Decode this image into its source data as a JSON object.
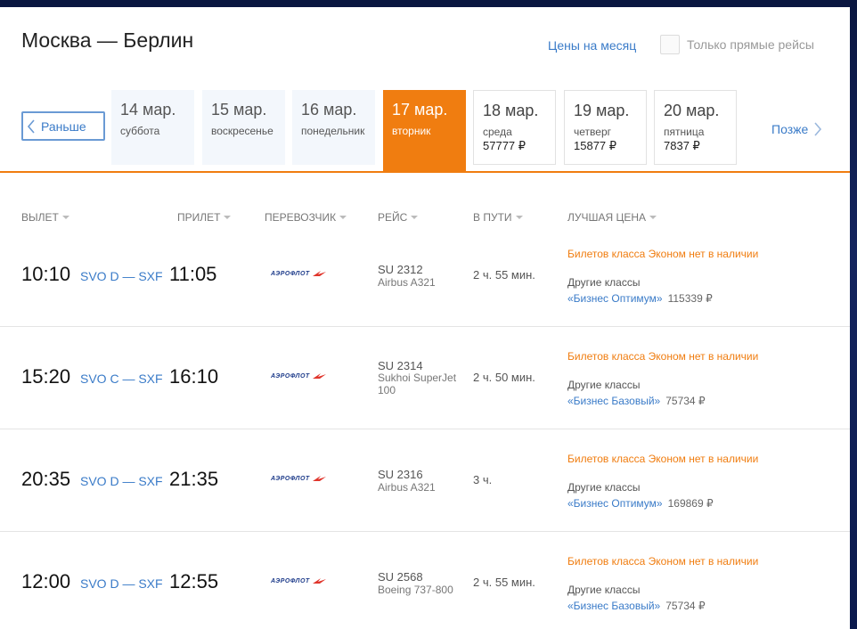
{
  "header": {
    "route": "Москва — Берлин",
    "month_prices_link": "Цены на месяц",
    "direct_only_label": "Только прямые рейсы"
  },
  "date_nav": {
    "prev_label": "Раньше",
    "next_label": "Позже",
    "dates": [
      {
        "date": "14 мар.",
        "weekday": "суббота",
        "price": "",
        "state": "past"
      },
      {
        "date": "15 мар.",
        "weekday": "воскресенье",
        "price": "",
        "state": "past"
      },
      {
        "date": "16 мар.",
        "weekday": "понедельник",
        "price": "",
        "state": "past"
      },
      {
        "date": "17 мар.",
        "weekday": "вторник",
        "price": "",
        "state": "active"
      },
      {
        "date": "18 мар.",
        "weekday": "среда",
        "price": "57777 ₽",
        "state": "future"
      },
      {
        "date": "19 мар.",
        "weekday": "четверг",
        "price": "15877 ₽",
        "state": "future"
      },
      {
        "date": "20 мар.",
        "weekday": "пятница",
        "price": "7837 ₽",
        "state": "future"
      }
    ]
  },
  "columns": {
    "departure": "ВЫЛЕТ",
    "arrival": "ПРИЛЕТ",
    "carrier": "ПЕРЕВОЗЧИК",
    "flight": "РЕЙС",
    "duration": "В ПУТИ",
    "best_price": "ЛУЧШАЯ ЦЕНА"
  },
  "flights": [
    {
      "dep": "10:10",
      "airports": "SVO D — SXF",
      "arr": "11:05",
      "airline": "АЭРОФЛОТ",
      "flight_no": "SU 2312",
      "aircraft": "Airbus A321",
      "duration": "2 ч. 55 мин.",
      "no_economy": "Билетов класса Эконом нет в наличии",
      "other_classes": "Другие классы",
      "fare_name": "«Бизнес Оптимум»",
      "fare_price": "115339 ₽"
    },
    {
      "dep": "15:20",
      "airports": "SVO C — SXF",
      "arr": "16:10",
      "airline": "АЭРОФЛОТ",
      "flight_no": "SU 2314",
      "aircraft": "Sukhoi SuperJet 100",
      "duration": "2 ч. 50 мин.",
      "no_economy": "Билетов класса Эконом нет в наличии",
      "other_classes": "Другие классы",
      "fare_name": "«Бизнес Базовый»",
      "fare_price": "75734 ₽"
    },
    {
      "dep": "20:35",
      "airports": "SVO D — SXF",
      "arr": "21:35",
      "airline": "АЭРОФЛОТ",
      "flight_no": "SU 2316",
      "aircraft": "Airbus A321",
      "duration": "3 ч.",
      "no_economy": "Билетов класса Эконом нет в наличии",
      "other_classes": "Другие классы",
      "fare_name": "«Бизнес Оптимум»",
      "fare_price": "169869 ₽"
    },
    {
      "dep": "12:00",
      "airports": "SVO D — SXF",
      "arr": "12:55",
      "airline": "АЭРОФЛОТ",
      "flight_no": "SU 2568",
      "aircraft": "Boeing 737-800",
      "duration": "2 ч. 55 мин.",
      "no_economy": "Билетов класса Эконом нет в наличии",
      "other_classes": "Другие классы",
      "fare_name": "«Бизнес Базовый»",
      "fare_price": "75734 ₽"
    }
  ],
  "colors": {
    "accent_orange": "#f07d10",
    "link_blue": "#3a7bc8",
    "airline_blue": "#1d3b8a",
    "airline_red": "#e0352b"
  }
}
